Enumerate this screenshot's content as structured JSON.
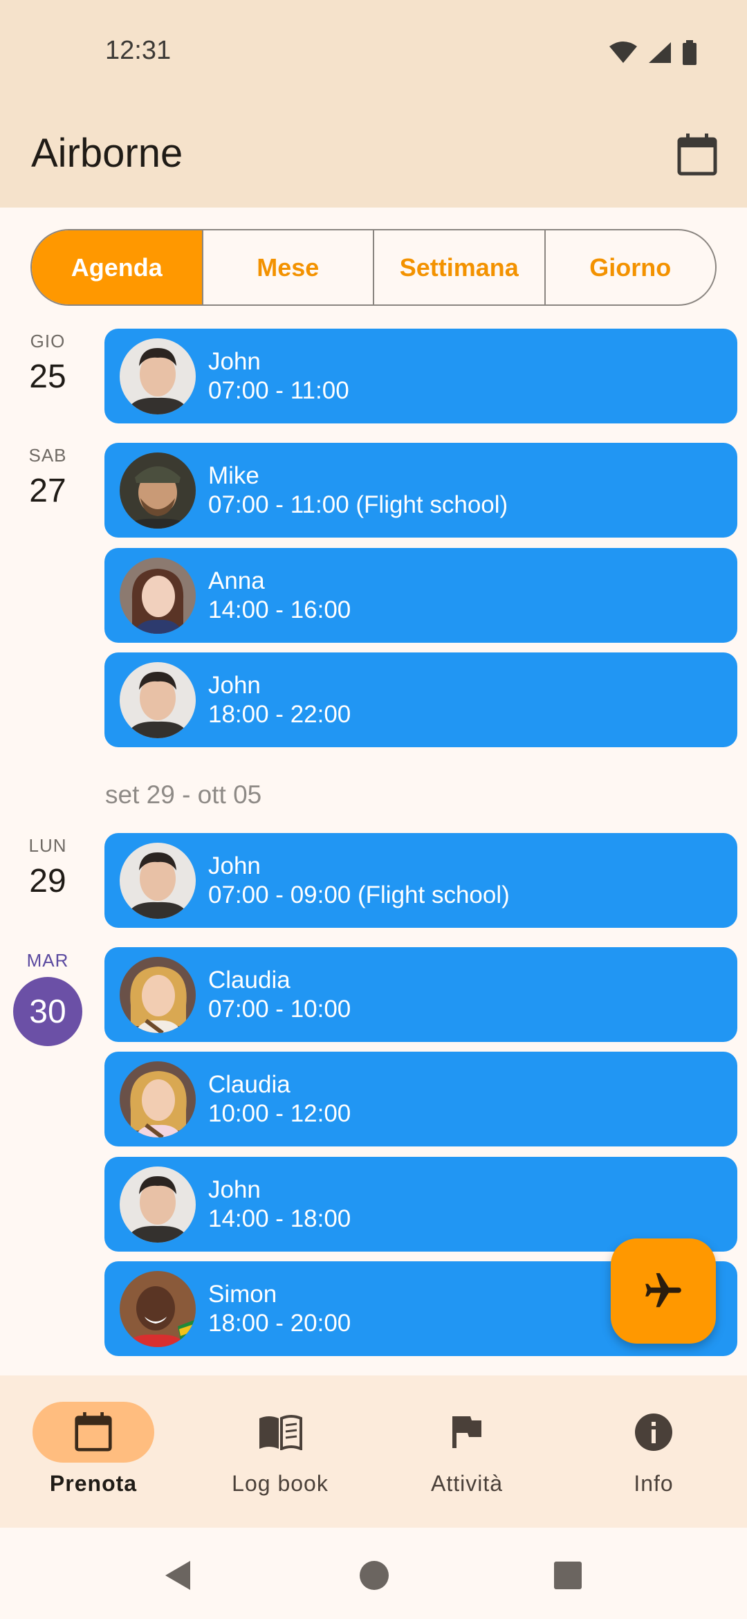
{
  "status": {
    "time": "12:31"
  },
  "app": {
    "title": "Airborne"
  },
  "tabs": [
    "Agenda",
    "Mese",
    "Settimana",
    "Giorno"
  ],
  "days": [
    {
      "dow": "GIO",
      "num": "25"
    },
    {
      "dow": "SAB",
      "num": "27"
    },
    {
      "dow": "LUN",
      "num": "29"
    },
    {
      "dow": "MAR",
      "num": "30"
    }
  ],
  "week_separator": "set 29 - ott 05",
  "events": [
    {
      "name": "John",
      "time": "07:00 - 11:00",
      "avatar": "john"
    },
    {
      "name": "Mike",
      "time": "07:00 - 11:00 (Flight school)",
      "avatar": "mike"
    },
    {
      "name": "Anna",
      "time": "14:00 - 16:00",
      "avatar": "anna"
    },
    {
      "name": "John",
      "time": "18:00 - 22:00",
      "avatar": "john"
    },
    {
      "name": "John",
      "time": "07:00 - 09:00 (Flight school)",
      "avatar": "john"
    },
    {
      "name": "Claudia",
      "time": "07:00 - 10:00",
      "avatar": "claudia"
    },
    {
      "name": "Claudia",
      "time": "10:00 - 12:00",
      "avatar": "claudia"
    },
    {
      "name": "John",
      "time": "14:00 - 18:00",
      "avatar": "john"
    },
    {
      "name": "Simon",
      "time": "18:00 - 20:00",
      "avatar": "simon"
    }
  ],
  "nav": [
    "Prenota",
    "Log book",
    "Attività",
    "Info"
  ],
  "colors": {
    "accent": "#ff9800",
    "event": "#2196f3",
    "today": "#6b50a6",
    "header": "#f5e2cb"
  }
}
